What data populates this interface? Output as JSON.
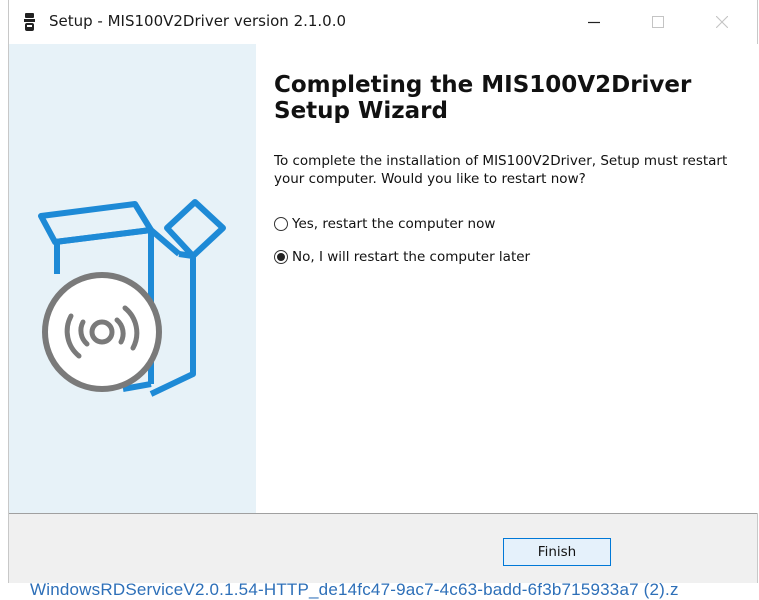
{
  "window": {
    "title": "Setup - MIS100V2Driver version 2.1.0.0",
    "minimize_icon": "minimize-icon",
    "maximize_icon": "maximize-icon",
    "close_icon": "close-icon"
  },
  "wizard": {
    "heading": "Completing the MIS100V2Driver Setup Wizard",
    "description": "To complete the installation of MIS100V2Driver, Setup must restart your computer. Would you like to restart now?",
    "options": [
      {
        "label": "Yes, restart the computer now",
        "selected": false
      },
      {
        "label": "No, I will restart the computer later",
        "selected": true
      }
    ],
    "illustration": "software-box-with-disc-icon"
  },
  "footer": {
    "finish_label": "Finish"
  },
  "background": {
    "partial_text": "WindowsRDServiceV2.0.1.54-HTTP_de14fc47-9ac7-4c63-badd-6f3b715933a7 (2).z"
  },
  "colors": {
    "side_panel": "#e7f2f8",
    "illustration_blue": "#1e8ad6",
    "disc_gray": "#7a7a7a",
    "button_border": "#0078d7",
    "footer_bg": "#f0f0f0"
  }
}
